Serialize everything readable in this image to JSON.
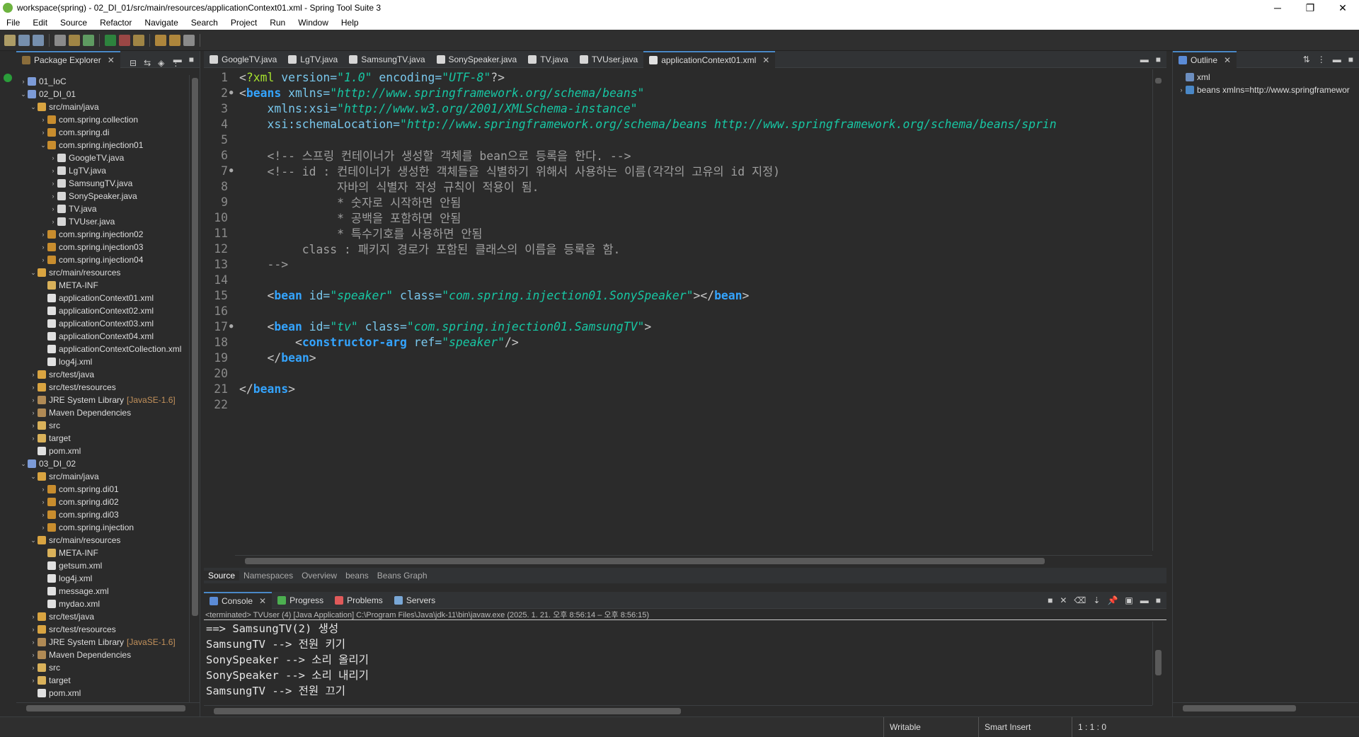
{
  "window": {
    "title": "workspace(spring) - 02_DI_01/src/main/resources/applicationContext01.xml - Spring Tool Suite 3",
    "minimize": "─",
    "maximize": "❐",
    "close": "✕"
  },
  "menu": [
    "File",
    "Edit",
    "Source",
    "Refactor",
    "Navigate",
    "Search",
    "Project",
    "Run",
    "Window",
    "Help"
  ],
  "package_explorer": {
    "title": "Package Explorer",
    "tree": [
      {
        "label": "01_IoC",
        "indent": 0,
        "arrow": "›",
        "icon": "project-icon"
      },
      {
        "label": "02_DI_01",
        "indent": 0,
        "arrow": "⌄",
        "icon": "project-icon"
      },
      {
        "label": "src/main/java",
        "indent": 1,
        "arrow": "⌄",
        "icon": "source-folder-icon"
      },
      {
        "label": "com.spring.collection",
        "indent": 2,
        "arrow": "›",
        "icon": "package-icon"
      },
      {
        "label": "com.spring.di",
        "indent": 2,
        "arrow": "›",
        "icon": "package-icon"
      },
      {
        "label": "com.spring.injection01",
        "indent": 2,
        "arrow": "⌄",
        "icon": "package-icon"
      },
      {
        "label": "GoogleTV.java",
        "indent": 3,
        "arrow": "›",
        "icon": "java-file-icon"
      },
      {
        "label": "LgTV.java",
        "indent": 3,
        "arrow": "›",
        "icon": "java-file-icon"
      },
      {
        "label": "SamsungTV.java",
        "indent": 3,
        "arrow": "›",
        "icon": "java-file-icon"
      },
      {
        "label": "SonySpeaker.java",
        "indent": 3,
        "arrow": "›",
        "icon": "java-file-icon"
      },
      {
        "label": "TV.java",
        "indent": 3,
        "arrow": "›",
        "icon": "java-file-icon"
      },
      {
        "label": "TVUser.java",
        "indent": 3,
        "arrow": "›",
        "icon": "java-file-icon"
      },
      {
        "label": "com.spring.injection02",
        "indent": 2,
        "arrow": "›",
        "icon": "package-icon"
      },
      {
        "label": "com.spring.injection03",
        "indent": 2,
        "arrow": "›",
        "icon": "package-icon"
      },
      {
        "label": "com.spring.injection04",
        "indent": 2,
        "arrow": "›",
        "icon": "package-icon"
      },
      {
        "label": "src/main/resources",
        "indent": 1,
        "arrow": "⌄",
        "icon": "source-folder-icon"
      },
      {
        "label": "META-INF",
        "indent": 2,
        "arrow": "",
        "icon": "folder-icon"
      },
      {
        "label": "applicationContext01.xml",
        "indent": 2,
        "arrow": "",
        "icon": "xml-file-icon"
      },
      {
        "label": "applicationContext02.xml",
        "indent": 2,
        "arrow": "",
        "icon": "xml-file-icon"
      },
      {
        "label": "applicationContext03.xml",
        "indent": 2,
        "arrow": "",
        "icon": "xml-file-icon"
      },
      {
        "label": "applicationContext04.xml",
        "indent": 2,
        "arrow": "",
        "icon": "xml-file-icon"
      },
      {
        "label": "applicationContextCollection.xml",
        "indent": 2,
        "arrow": "",
        "icon": "xml-file-icon"
      },
      {
        "label": "log4j.xml",
        "indent": 2,
        "arrow": "",
        "icon": "xml-file-icon"
      },
      {
        "label": "src/test/java",
        "indent": 1,
        "arrow": "›",
        "icon": "source-folder-icon"
      },
      {
        "label": "src/test/resources",
        "indent": 1,
        "arrow": "›",
        "icon": "source-folder-icon"
      },
      {
        "label": "JRE System Library",
        "extra": "[JavaSE-1.6]",
        "indent": 1,
        "arrow": "›",
        "icon": "library-icon"
      },
      {
        "label": "Maven Dependencies",
        "indent": 1,
        "arrow": "›",
        "icon": "library-icon"
      },
      {
        "label": "src",
        "indent": 1,
        "arrow": "›",
        "icon": "folder-icon"
      },
      {
        "label": "target",
        "indent": 1,
        "arrow": "›",
        "icon": "folder-icon"
      },
      {
        "label": "pom.xml",
        "indent": 1,
        "arrow": "",
        "icon": "xml-file-icon"
      },
      {
        "label": "03_DI_02",
        "indent": 0,
        "arrow": "⌄",
        "icon": "project-icon"
      },
      {
        "label": "src/main/java",
        "indent": 1,
        "arrow": "⌄",
        "icon": "source-folder-icon"
      },
      {
        "label": "com.spring.di01",
        "indent": 2,
        "arrow": "›",
        "icon": "package-icon"
      },
      {
        "label": "com.spring.di02",
        "indent": 2,
        "arrow": "›",
        "icon": "package-icon"
      },
      {
        "label": "com.spring.di03",
        "indent": 2,
        "arrow": "›",
        "icon": "package-icon"
      },
      {
        "label": "com.spring.injection",
        "indent": 2,
        "arrow": "›",
        "icon": "package-icon"
      },
      {
        "label": "src/main/resources",
        "indent": 1,
        "arrow": "⌄",
        "icon": "source-folder-icon"
      },
      {
        "label": "META-INF",
        "indent": 2,
        "arrow": "",
        "icon": "folder-icon"
      },
      {
        "label": "getsum.xml",
        "indent": 2,
        "arrow": "",
        "icon": "xml-file-icon"
      },
      {
        "label": "log4j.xml",
        "indent": 2,
        "arrow": "",
        "icon": "xml-file-icon"
      },
      {
        "label": "message.xml",
        "indent": 2,
        "arrow": "",
        "icon": "xml-file-icon"
      },
      {
        "label": "mydao.xml",
        "indent": 2,
        "arrow": "",
        "icon": "xml-file-icon"
      },
      {
        "label": "src/test/java",
        "indent": 1,
        "arrow": "›",
        "icon": "source-folder-icon"
      },
      {
        "label": "src/test/resources",
        "indent": 1,
        "arrow": "›",
        "icon": "source-folder-icon"
      },
      {
        "label": "JRE System Library",
        "extra": "[JavaSE-1.6]",
        "indent": 1,
        "arrow": "›",
        "icon": "library-icon"
      },
      {
        "label": "Maven Dependencies",
        "indent": 1,
        "arrow": "›",
        "icon": "library-icon"
      },
      {
        "label": "src",
        "indent": 1,
        "arrow": "›",
        "icon": "folder-icon"
      },
      {
        "label": "target",
        "indent": 1,
        "arrow": "›",
        "icon": "folder-icon"
      },
      {
        "label": "pom.xml",
        "indent": 1,
        "arrow": "",
        "icon": "xml-file-icon"
      }
    ]
  },
  "editor": {
    "tabs": [
      {
        "label": "GoogleTV.java",
        "icon": "java-file-icon",
        "active": false
      },
      {
        "label": "LgTV.java",
        "icon": "java-file-icon",
        "active": false
      },
      {
        "label": "SamsungTV.java",
        "icon": "java-file-icon",
        "active": false
      },
      {
        "label": "SonySpeaker.java",
        "icon": "java-file-icon",
        "active": false
      },
      {
        "label": "TV.java",
        "icon": "java-file-icon",
        "active": false
      },
      {
        "label": "TVUser.java",
        "icon": "java-file-icon",
        "active": false
      },
      {
        "label": "applicationContext01.xml",
        "icon": "xml-file-icon",
        "active": true
      }
    ],
    "lines": [
      {
        "n": "1",
        "fold": "",
        "tokens": [
          [
            "br",
            "<"
          ],
          [
            "pi",
            "?xml"
          ],
          [
            "attr",
            " version="
          ],
          [
            "val",
            "\"1.0\""
          ],
          [
            "attr",
            " encoding="
          ],
          [
            "val",
            "\"UTF-8\""
          ],
          [
            "br",
            "?>"
          ]
        ]
      },
      {
        "n": "2",
        "fold": "●",
        "tokens": [
          [
            "br",
            "<"
          ],
          [
            "tag",
            "beans"
          ],
          [
            "attr",
            " xmlns="
          ],
          [
            "val",
            "\"http://www.springframework.org/schema/beans\""
          ]
        ]
      },
      {
        "n": "3",
        "fold": "",
        "tokens": [
          [
            "attr",
            "    xmlns:xsi="
          ],
          [
            "val",
            "\"http://www.w3.org/2001/XMLSchema-instance\""
          ]
        ]
      },
      {
        "n": "4",
        "fold": "",
        "tokens": [
          [
            "attr",
            "    xsi:schemaLocation="
          ],
          [
            "val",
            "\"http://www.springframework.org/schema/beans http://www.springframework.org/schema/beans/sprin"
          ]
        ]
      },
      {
        "n": "5",
        "fold": "",
        "tokens": []
      },
      {
        "n": "6",
        "fold": "",
        "tokens": [
          [
            "com",
            "    <!-- 스프링 컨테이너가 생성할 객체를 bean으로 등록을 한다. -->"
          ]
        ]
      },
      {
        "n": "7",
        "fold": "●",
        "tokens": [
          [
            "com",
            "    <!-- id : 컨테이너가 생성한 객체들을 식별하기 위해서 사용하는 이름(각각의 고유의 id 지정)"
          ]
        ]
      },
      {
        "n": "8",
        "fold": "",
        "tokens": [
          [
            "com",
            "              자바의 식별자 작성 규칙이 적용이 됨."
          ]
        ]
      },
      {
        "n": "9",
        "fold": "",
        "tokens": [
          [
            "com",
            "              * 숫자로 시작하면 안됨"
          ]
        ]
      },
      {
        "n": "10",
        "fold": "",
        "tokens": [
          [
            "com",
            "              * 공백을 포함하면 안됨"
          ]
        ]
      },
      {
        "n": "11",
        "fold": "",
        "tokens": [
          [
            "com",
            "              * 특수기호를 사용하면 안됨"
          ]
        ]
      },
      {
        "n": "12",
        "fold": "",
        "tokens": [
          [
            "com",
            "         class : 패키지 경로가 포함된 클래스의 이름을 등록을 함."
          ]
        ]
      },
      {
        "n": "13",
        "fold": "",
        "tokens": [
          [
            "com",
            "    -->"
          ]
        ]
      },
      {
        "n": "14",
        "fold": "",
        "tokens": []
      },
      {
        "n": "15",
        "fold": "",
        "tokens": [
          [
            "br",
            "    <"
          ],
          [
            "tag",
            "bean"
          ],
          [
            "attr",
            " id="
          ],
          [
            "val",
            "\"speaker\""
          ],
          [
            "attr",
            " class="
          ],
          [
            "val",
            "\"com.spring.injection01.SonySpeaker\""
          ],
          [
            "br",
            "></"
          ],
          [
            "tag",
            "bean"
          ],
          [
            "br",
            ">"
          ]
        ]
      },
      {
        "n": "16",
        "fold": "",
        "tokens": []
      },
      {
        "n": "17",
        "fold": "●",
        "tokens": [
          [
            "br",
            "    <"
          ],
          [
            "tag",
            "bean"
          ],
          [
            "attr",
            " id="
          ],
          [
            "val",
            "\"tv\""
          ],
          [
            "attr",
            " class="
          ],
          [
            "val",
            "\"com.spring.injection01.SamsungTV\""
          ],
          [
            "br",
            ">"
          ]
        ]
      },
      {
        "n": "18",
        "fold": "",
        "tokens": [
          [
            "br",
            "        <"
          ],
          [
            "tag",
            "constructor-arg"
          ],
          [
            "attr",
            " ref="
          ],
          [
            "val",
            "\"speaker\""
          ],
          [
            "br",
            "/>"
          ]
        ]
      },
      {
        "n": "19",
        "fold": "",
        "tokens": [
          [
            "br",
            "    </"
          ],
          [
            "tag",
            "bean"
          ],
          [
            "br",
            ">"
          ]
        ]
      },
      {
        "n": "20",
        "fold": "",
        "tokens": []
      },
      {
        "n": "21",
        "fold": "",
        "tokens": [
          [
            "br",
            "</"
          ],
          [
            "tag",
            "beans"
          ],
          [
            "br",
            ">"
          ]
        ]
      },
      {
        "n": "22",
        "fold": "",
        "tokens": []
      }
    ],
    "bottom_tabs": [
      "Source",
      "Namespaces",
      "Overview",
      "beans",
      "Beans Graph"
    ]
  },
  "outline": {
    "title": "Outline",
    "items": [
      {
        "label": "xml",
        "icon": "xml-decl-icon",
        "arrow": ""
      },
      {
        "label": "beans xmlns=http://www.springframewor",
        "icon": "element-icon",
        "arrow": "›"
      }
    ]
  },
  "console": {
    "tabs": [
      {
        "label": "Console",
        "icon": "console-icon",
        "active": true
      },
      {
        "label": "Progress",
        "icon": "progress-icon",
        "active": false
      },
      {
        "label": "Problems",
        "icon": "problems-icon",
        "active": false
      },
      {
        "label": "Servers",
        "icon": "servers-icon",
        "active": false
      }
    ],
    "info": "<terminated> TVUser (4) [Java Application] C:\\Program Files\\Java\\jdk-11\\bin\\javaw.exe  (2025. 1. 21. 오후 8:56:14 – 오후 8:56:15)",
    "output": [
      "==> SamsungTV(2) 생성",
      "SamsungTV --> 전원 키기",
      "SonySpeaker --> 소리 올리기",
      "SonySpeaker --> 소리 내리기",
      "SamsungTV --> 전원 끄기"
    ]
  },
  "status": {
    "writable": "Writable",
    "insert_mode": "Smart Insert",
    "position": "1 : 1 : 0"
  },
  "colors": {
    "accent": "#4a88c7",
    "tag": "#34a4ff",
    "attr": "#79c7ec",
    "value": "#17c6a3",
    "comment": "#9f9f9f"
  }
}
